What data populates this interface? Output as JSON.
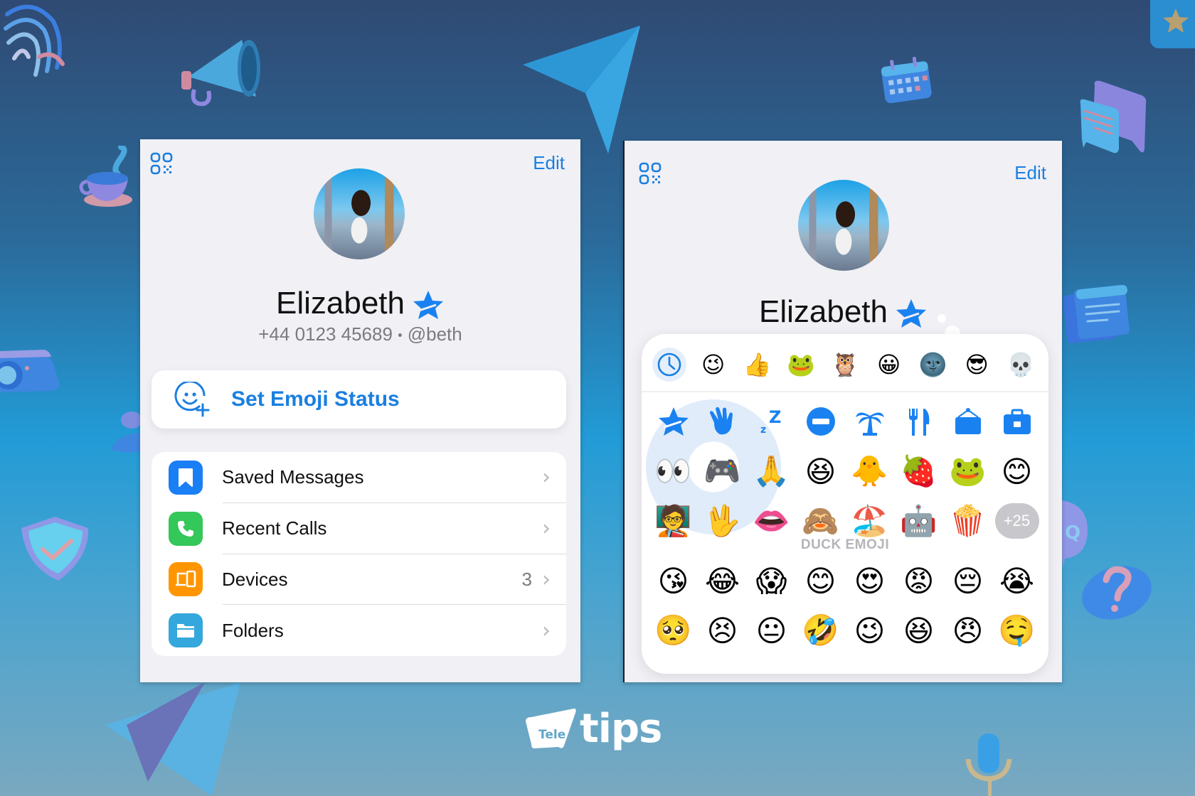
{
  "left_panel": {
    "qr_icon": "qr-code-icon",
    "edit_label": "Edit",
    "profile": {
      "name": "Elizabeth",
      "status_icon": "premium-star-icon",
      "phone": "+44 0123 45689",
      "separator": "•",
      "username": "@beth"
    },
    "set_status": {
      "icon": "smiley-plus-icon",
      "label": "Set Emoji Status"
    },
    "menu": [
      {
        "label": "Saved Messages",
        "icon": "bookmark-icon",
        "color": "#1a7ff5",
        "value": ""
      },
      {
        "label": "Recent Calls",
        "icon": "phone-icon",
        "color": "#34c759",
        "value": ""
      },
      {
        "label": "Devices",
        "icon": "devices-icon",
        "color": "#ff9500",
        "value": "3"
      },
      {
        "label": "Folders",
        "icon": "folder-icon",
        "color": "#34a7dc",
        "value": ""
      }
    ]
  },
  "right_panel": {
    "qr_icon": "qr-code-icon",
    "edit_label": "Edit",
    "profile": {
      "name": "Elizabeth",
      "status_icon": "premium-star-icon"
    },
    "emoji_picker": {
      "tabs": [
        {
          "name": "recent-clock",
          "glyph": "🕓",
          "active": true
        },
        {
          "name": "duck-pack",
          "glyph": "😉"
        },
        {
          "name": "thumbs-up-pack",
          "glyph": "👍"
        },
        {
          "name": "frog-pack",
          "glyph": "🐸"
        },
        {
          "name": "owl-pack",
          "glyph": "🦉"
        },
        {
          "name": "smiley-pack",
          "glyph": "😀"
        },
        {
          "name": "moon-pack",
          "glyph": "🌚"
        },
        {
          "name": "cool-pack",
          "glyph": "😎"
        },
        {
          "name": "skull-pack",
          "glyph": "💀"
        }
      ],
      "recent_rows": [
        [
          "⭐",
          "👋",
          "💤",
          "⛔",
          "🌴",
          "🍴",
          "🪧",
          "💼"
        ],
        [
          "👀",
          "🎮",
          "🙏",
          "😆",
          "🐥",
          "🍓",
          "🐸",
          "😊"
        ],
        [
          "🧑‍🏫",
          "🖖",
          "👄",
          "🙈",
          "🏖️",
          "🤖",
          "🍿",
          "+25"
        ]
      ],
      "more_count": "+25",
      "section_title": "DUCK EMOJI",
      "duck_rows": [
        [
          "😘",
          "😂",
          "😱",
          "😊",
          "😍",
          "😡",
          "😔",
          "😭"
        ],
        [
          "🥺",
          "😣",
          "😐",
          "🤣",
          "😉",
          "😆",
          "😠",
          "🤤"
        ]
      ]
    }
  },
  "branding": {
    "logo_mark": "Tele",
    "logo_text": "tips"
  },
  "colors": {
    "accent": "#1a7fe0",
    "panel_bg": "#f0f0f5",
    "card_bg": "#ffffff"
  }
}
